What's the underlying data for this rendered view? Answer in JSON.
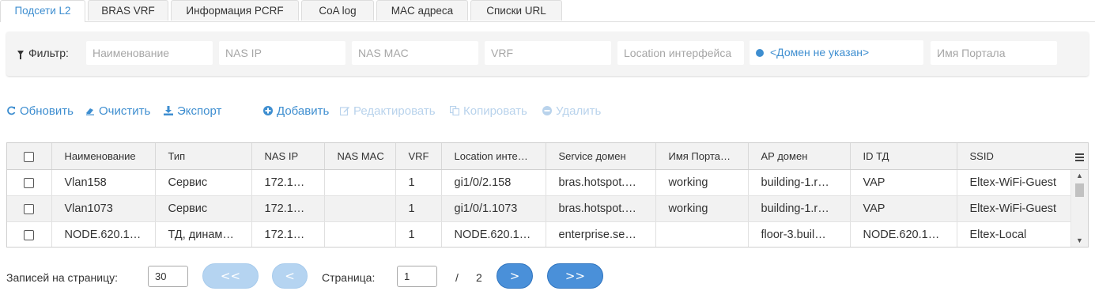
{
  "tabs": [
    "Подсети L2",
    "BRAS VRF",
    "Информация PCRF",
    "CoA log",
    "MAC адреса",
    "Списки URL"
  ],
  "filter": {
    "label": "Фильтр:",
    "name_placeholder": "Наименование",
    "nasip_placeholder": "NAS IP",
    "nasmac_placeholder": "NAS MAC",
    "vrf_placeholder": "VRF",
    "location_placeholder": "Location интерфейса",
    "domain": "<Домен не указан>",
    "portal_placeholder": "Имя Портала"
  },
  "toolbar": {
    "refresh": "Обновить",
    "clear": "Очистить",
    "export": "Экспорт",
    "add": "Добавить",
    "edit": "Редактировать",
    "copy": "Копировать",
    "delete": "Удалить"
  },
  "table": {
    "columns": [
      "Наименование",
      "Тип",
      "NAS IP",
      "NAS MAC",
      "VRF",
      "Location инте…",
      "Service домен",
      "Имя Порта…",
      "AP домен",
      "ID ТД",
      "SSID"
    ],
    "rows": [
      [
        "Vlan158",
        "Сервис",
        "172.1…",
        "",
        "1",
        "gi1/0/2.158",
        "bras.hotspot.…",
        "working",
        "building-1.r…",
        "VAP",
        "Eltex-WiFi-Guest"
      ],
      [
        "Vlan1073",
        "Сервис",
        "172.1…",
        "",
        "1",
        "gi1/0/1.1073",
        "bras.hotspot.…",
        "working",
        "building-1.r…",
        "VAP",
        "Eltex-WiFi-Guest"
      ],
      [
        "NODE.620.1…",
        "ТД, динам…",
        "172.1…",
        "",
        "1",
        "NODE.620.1…",
        "enterprise.se…",
        "",
        "floor-3.buil…",
        "NODE.620.1…",
        "Eltex-Local"
      ]
    ]
  },
  "pager": {
    "per_page_label": "Записей на страницу:",
    "per_page": "30",
    "first": "<<",
    "prev": "<",
    "page_label": "Страница:",
    "page": "1",
    "sep": "/",
    "total": "2",
    "next": ">",
    "last": ">>"
  },
  "colors": {
    "accent": "#3e8ed0",
    "button": "#4a90d9",
    "button_disabled": "#b5d4f1"
  }
}
